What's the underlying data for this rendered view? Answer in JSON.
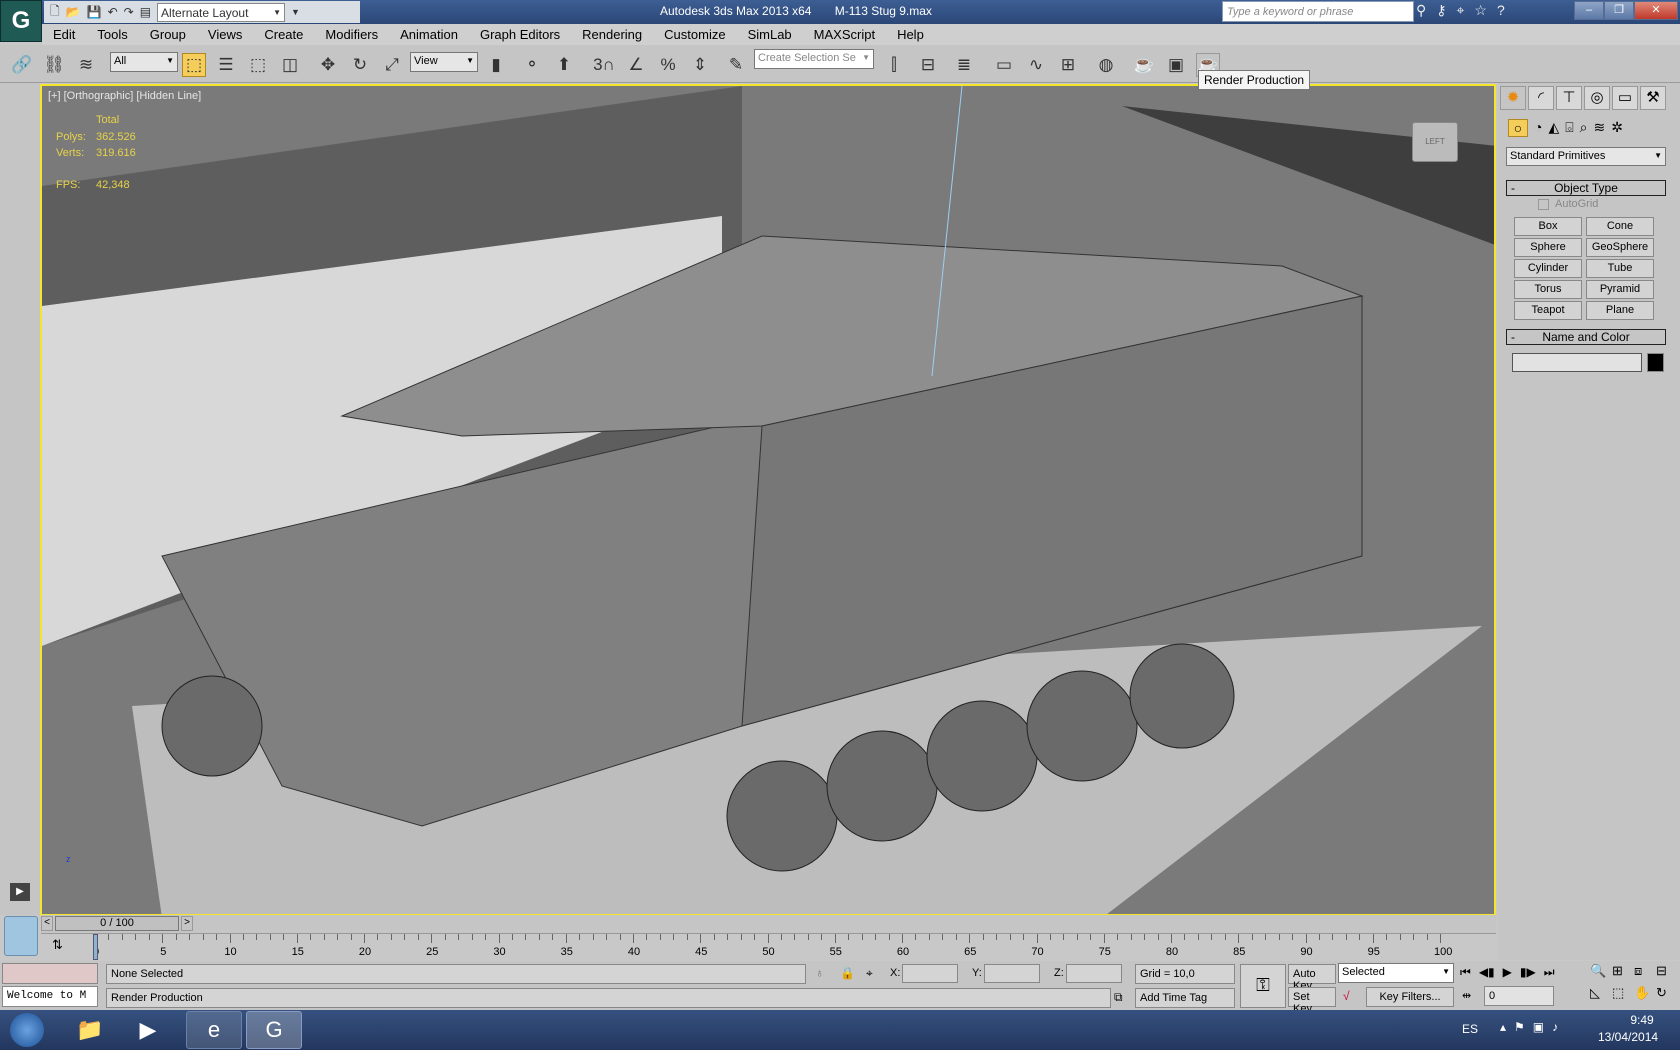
{
  "title_bar": {
    "app_title": "Autodesk 3ds Max  2013 x64",
    "file": "M-113 Stug 9.max",
    "layout": "Alternate Layout",
    "search_placeholder": "Type a keyword or phrase"
  },
  "menu": [
    "Edit",
    "Tools",
    "Group",
    "Views",
    "Create",
    "Modifiers",
    "Animation",
    "Graph Editors",
    "Rendering",
    "Customize",
    "SimLab",
    "MAXScript",
    "Help"
  ],
  "toolbar": {
    "filter": "All",
    "ref_coord": "View",
    "named_selection_placeholder": "Create Selection Se",
    "snap_label": "3",
    "tooltip": "Render Production"
  },
  "viewport": {
    "label": "[+] [Orthographic] [Hidden Line]",
    "stats": {
      "total": "Total",
      "polys_label": "Polys:",
      "polys": "362.526",
      "verts_label": "Verts:",
      "verts": "319.616",
      "fps_label": "FPS:",
      "fps": "42,348"
    },
    "viewcube_label": "LEFT",
    "axis_z": "z"
  },
  "command_panel": {
    "category": "Standard Primitives",
    "object_type_title": "Object Type",
    "autogrid": "AutoGrid",
    "buttons": [
      "Box",
      "Cone",
      "Sphere",
      "GeoSphere",
      "Cylinder",
      "Tube",
      "Torus",
      "Pyramid",
      "Teapot",
      "Plane"
    ],
    "name_color_title": "Name and Color",
    "name_value": "",
    "object_color": "#000000",
    "collapse": "-"
  },
  "timeline": {
    "slider_label": "0 / 100",
    "prev": "<",
    "next": ">",
    "ticks": [
      0,
      5,
      10,
      15,
      20,
      25,
      30,
      35,
      40,
      45,
      50,
      55,
      60,
      65,
      70,
      75,
      80,
      85,
      90,
      95,
      100
    ],
    "current_frame": 0
  },
  "status": {
    "selection": "None Selected",
    "prompt": "Render Production",
    "listener": "Welcome to M",
    "x_label": "X:",
    "y_label": "Y:",
    "z_label": "Z:",
    "grid": "Grid = 10,0",
    "add_time_tag": "Add Time Tag",
    "auto_key": "Auto Key",
    "set_key": "Set Key",
    "key_mode": "Selected",
    "key_filters": "Key Filters...",
    "frame": "0"
  },
  "taskbar": {
    "lang": "ES",
    "time": "9:49",
    "date": "13/04/2014"
  },
  "colors": {
    "viewport_border": "#f3e62a",
    "stats_text": "#e8d24a",
    "accent_active": "#f5cd5b"
  }
}
